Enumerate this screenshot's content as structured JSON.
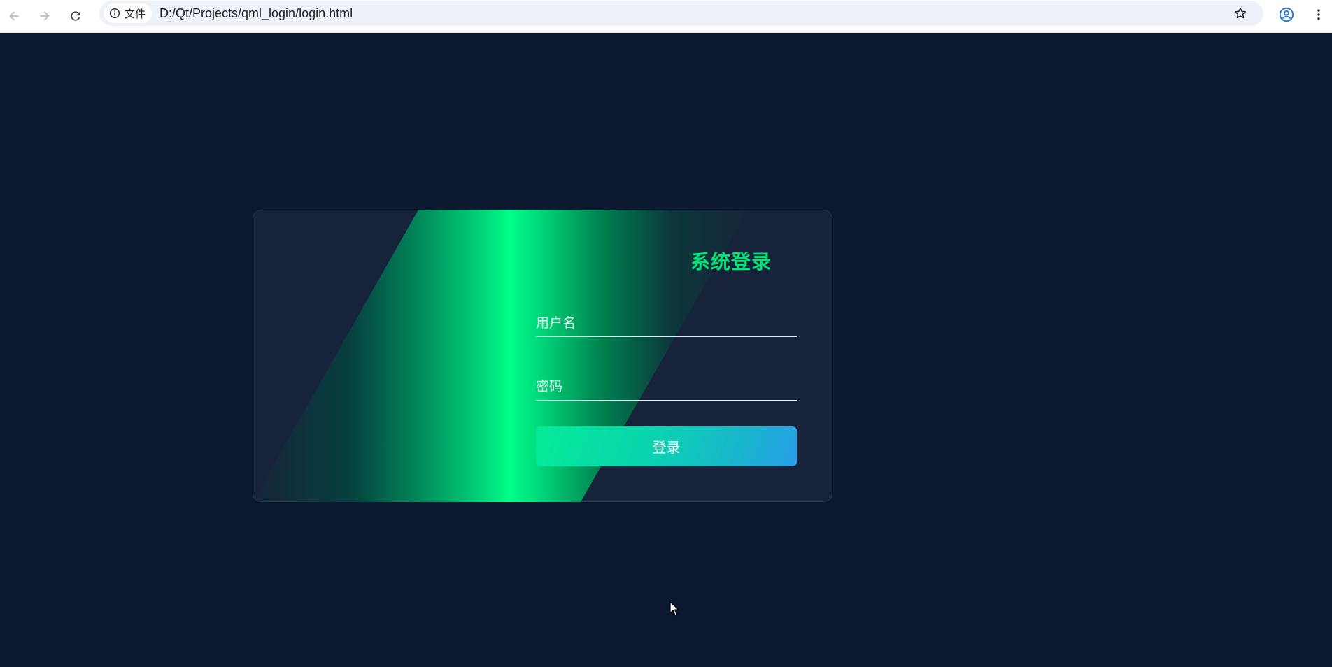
{
  "browser": {
    "site_chip_label": "文件",
    "url": "D:/Qt/Projects/qml_login/login.html",
    "icons": {
      "back": "arrow-left-icon",
      "forward": "arrow-right-icon",
      "reload": "reload-icon",
      "info": "info-icon",
      "bookmark": "star-icon",
      "profile": "profile-icon",
      "menu": "kebab-menu-icon"
    }
  },
  "login": {
    "title": "系统登录",
    "username_placeholder": "用户名",
    "password_placeholder": "密码",
    "submit_label": "登录"
  },
  "colors": {
    "page_background": "#0b1830",
    "card_background": "#17233a",
    "accent_green": "#00e676",
    "button_gradient_start": "#04eb96",
    "button_gradient_end": "#2a9fe8"
  }
}
